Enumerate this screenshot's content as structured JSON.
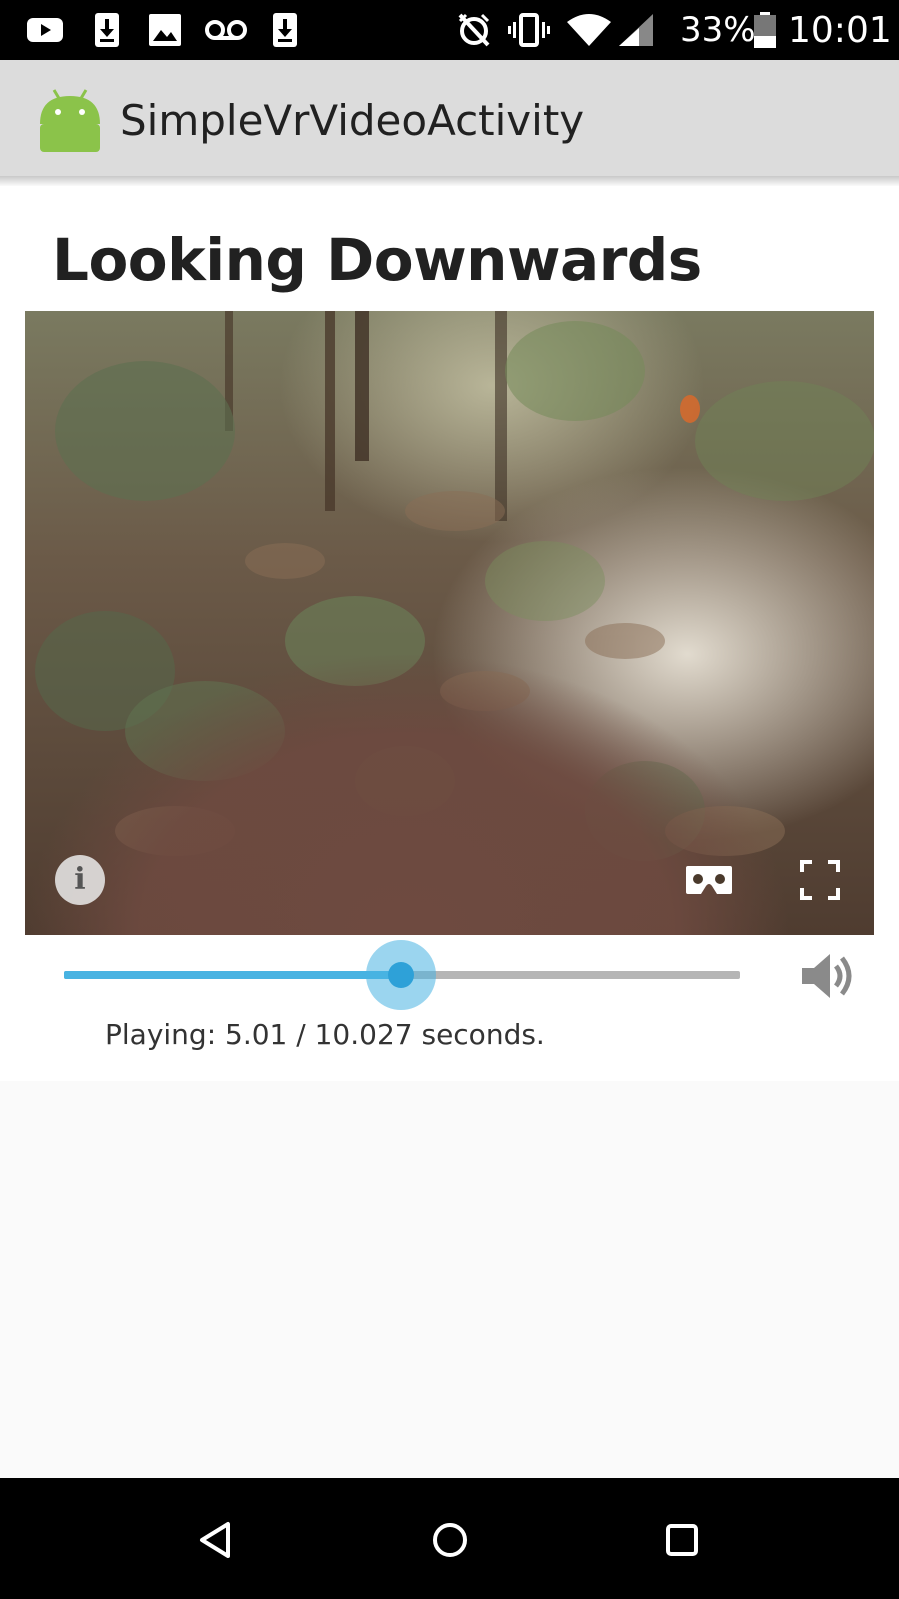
{
  "status_bar": {
    "battery_percent": "33%",
    "time": "10:01",
    "notification_icons": [
      "youtube-icon",
      "download-icon",
      "image-icon",
      "voicemail-icon",
      "download-icon"
    ],
    "system_icons": [
      "alarm-off-icon",
      "vibrate-icon",
      "wifi-icon",
      "signal-icon",
      "battery-icon"
    ]
  },
  "app_bar": {
    "title": "SimpleVrVideoActivity",
    "logo_icon": "android-icon"
  },
  "page": {
    "title": "Looking Downwards"
  },
  "video": {
    "controls": [
      "info-icon",
      "cardboard-icon",
      "fullscreen-icon"
    ]
  },
  "playback": {
    "progress_fraction": 0.5,
    "status_text": "Playing: 5.01 / 10.027 seconds."
  },
  "nav_bar": {
    "buttons": [
      "back-icon",
      "home-icon",
      "recents-icon"
    ]
  },
  "colors": {
    "accent": "#48b3e2",
    "android_green": "#8bc34a",
    "app_bar": "#dcdcdc"
  }
}
